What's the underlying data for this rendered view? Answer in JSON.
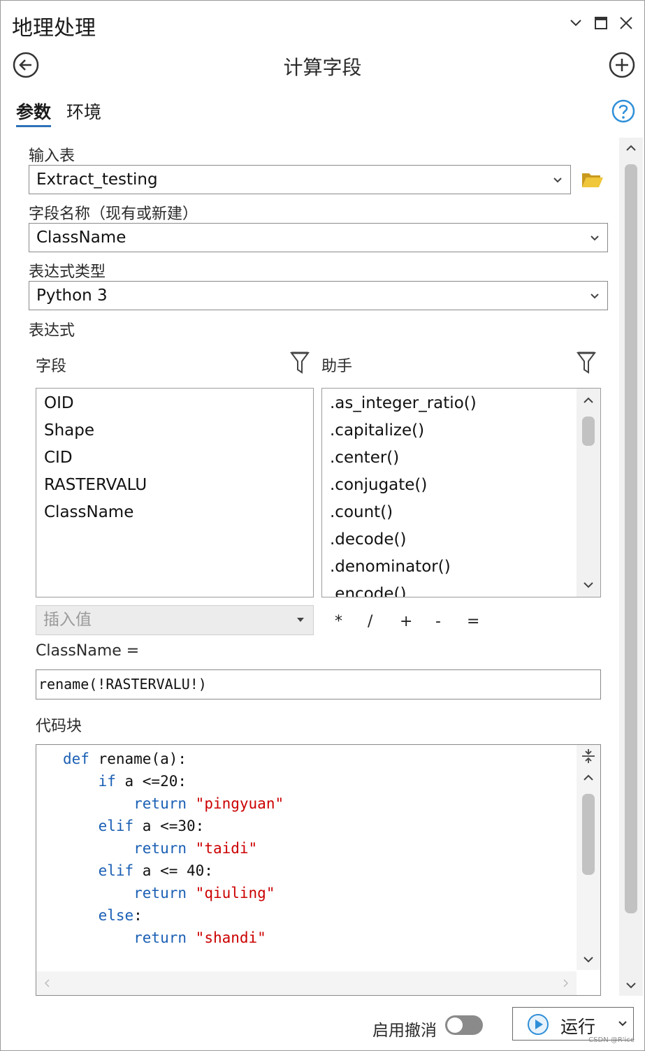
{
  "window": {
    "title": "地理处理",
    "tool_title": "计算字段"
  },
  "tabs": [
    "参数",
    "环境"
  ],
  "params": {
    "input_table_label": "输入表",
    "input_table_value": "Extract_testing",
    "field_name_label": "字段名称（现有或新建）",
    "field_name_value": "ClassName",
    "expression_type_label": "表达式类型",
    "expression_type_value": "Python 3",
    "expression_label": "表达式",
    "fields_label": "字段",
    "helpers_label": "助手",
    "fields": [
      "OID",
      "Shape",
      "CID",
      "RASTERVALU",
      "ClassName"
    ],
    "helpers": [
      ".as_integer_ratio()",
      ".capitalize()",
      ".center()",
      ".conjugate()",
      ".count()",
      ".decode()",
      ".denominator()",
      ".encode()"
    ],
    "insert_value_placeholder": "插入值",
    "operators": [
      "*",
      "/",
      "+",
      "-",
      "="
    ],
    "assign_label": "ClassName =",
    "expression_value": "rename(!RASTERVALU!)",
    "code_block_label": "代码块"
  },
  "code_lines": [
    [
      "def",
      " rename(a):",
      ""
    ],
    [
      "    if",
      " a <=20:",
      ""
    ],
    [
      "        return",
      " ",
      "\"pingyuan\""
    ],
    [
      "    elif",
      " a <=30:",
      ""
    ],
    [
      "        return",
      " ",
      "\"taidi\""
    ],
    [
      "    elif",
      " a <= 40:",
      ""
    ],
    [
      "        return",
      " ",
      "\"qiuling\""
    ],
    [
      "    else",
      ":",
      ""
    ],
    [
      "        return",
      " ",
      "\"shandi\""
    ]
  ],
  "footer": {
    "undo_label": "启用撤消",
    "undo_enabled": false,
    "run_label": "运行"
  },
  "watermark": "CSDN @R'ice",
  "colors": {
    "accent": "#2e72b8",
    "folder": "#e0b62c",
    "keyword": "#1a5fb4",
    "string": "#cc0000"
  }
}
